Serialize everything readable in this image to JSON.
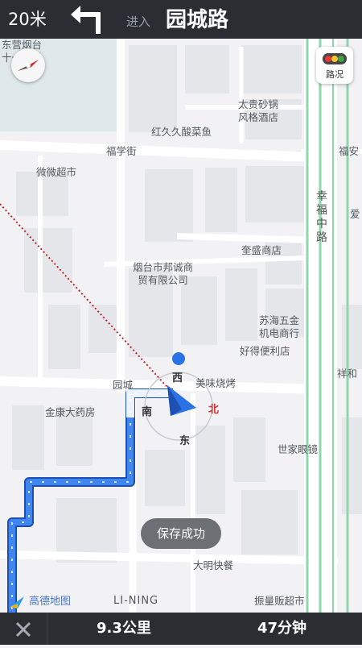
{
  "nav": {
    "distance": "20米",
    "turn_icon": "turn-left-icon",
    "enter_label": "进入",
    "road_name": "园城路"
  },
  "map": {
    "pois": {
      "school_partial": "东营烟台",
      "school_partial2": "十一中学",
      "taigui_1": "太贵砂锅",
      "taigui_2": "风格酒店",
      "hongjiu": "红久久酸菜鱼",
      "fuxue": "福学街",
      "weiwei": "微微超市",
      "fuan": "福安",
      "xingfu": "幸福中路",
      "ai": "爱",
      "kuisheng": "奎盛商店",
      "bangcheng_1": "烟台市邦诚商",
      "bangcheng_2": "贸有限公司",
      "suhai_1": "苏海五金",
      "suhai_2": "机电商行",
      "haode": "好得便利店",
      "xianghe": "祥和",
      "meiwei": "美味烧烤",
      "yuancheng_partial": "园城",
      "jinkang": "金康大药房",
      "shijia": "世家眼镜",
      "daming": "大明快餐",
      "zhenguan": "振量贩超市",
      "lining": "LI-NING"
    },
    "compass_dirs": {
      "west": "西",
      "north": "北",
      "east": "东",
      "south": "南"
    },
    "traffic_label": "路况",
    "toast": "保存成功",
    "logo": "高德地图"
  },
  "bottom": {
    "close_icon": "close-icon",
    "remaining_distance": "9.3公里",
    "remaining_time": "47分钟"
  },
  "colors": {
    "bar": "#2b2d33",
    "route": "#2b72e6",
    "road": "#ffffff",
    "block": "#e5e6ea",
    "avenue": "#8fd6ad",
    "toast": "#6c6f73"
  }
}
